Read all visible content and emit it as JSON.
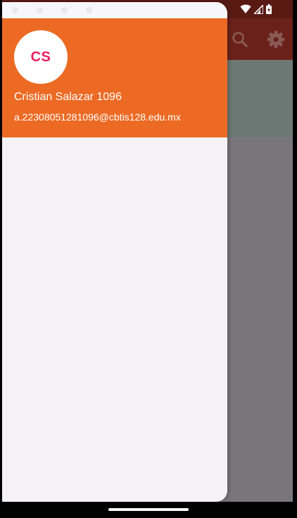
{
  "app": {
    "actions": [
      {
        "icon": "search-icon"
      },
      {
        "icon": "gear-icon"
      }
    ]
  },
  "statusbar": {
    "icons": [
      "wifi-icon",
      "signal-icon",
      "battery-icon"
    ]
  },
  "drawer": {
    "avatar_initials": "CS",
    "account_name": "Cristian Salazar 1096",
    "account_email": "a.22308051281096@cbtis128.edu.mx"
  },
  "colors": {
    "drawer_header": "#ec6a23",
    "avatar_text": "#e91e63",
    "drawer_background": "#f4f2f7",
    "scrim_app": "#79767a",
    "app_bar_dimmed": "#6b211a"
  }
}
